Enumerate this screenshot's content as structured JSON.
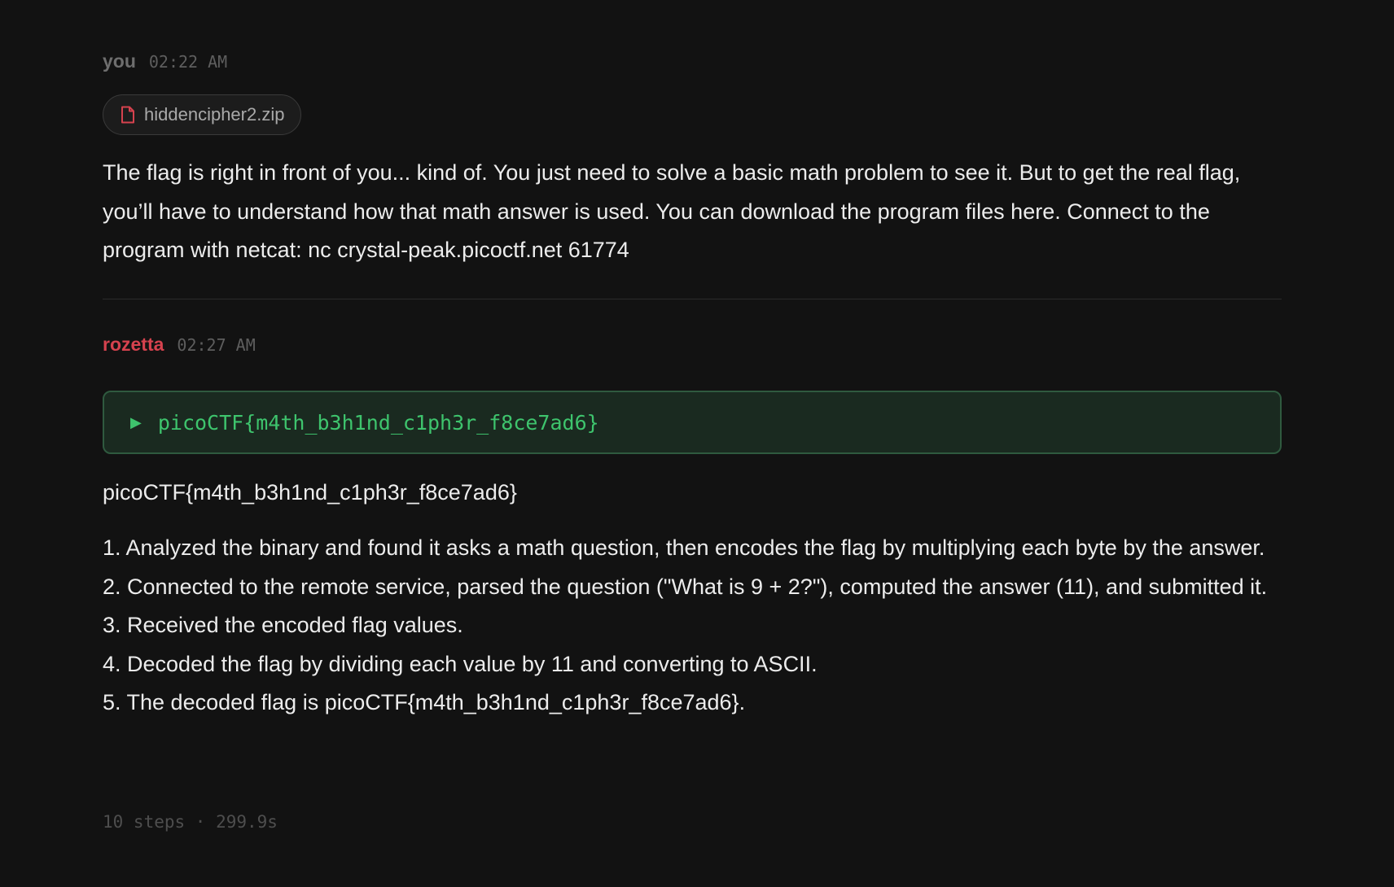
{
  "messages": {
    "user": {
      "author": "you",
      "time": "02:22 AM",
      "attachment": {
        "icon": "file-icon",
        "name": "hiddencipher2.zip"
      },
      "text": "The flag is right in front of you... kind of. You just need to solve a basic math problem to see it. But to get the real flag, you’ll have to understand how that math answer is used. You can download the program files here. Connect to the program with netcat: nc crystal-peak.picoctf.net 61774"
    },
    "bot": {
      "author": "rozetta",
      "time": "02:27 AM",
      "flag_box": {
        "icon": "play-icon",
        "value": "picoCTF{m4th_b3h1nd_c1ph3r_f8ce7ad6}"
      },
      "flag_text": "picoCTF{m4th_b3h1nd_c1ph3r_f8ce7ad6}",
      "steps": [
        "1. Analyzed the binary and found it asks a math question, then encodes the flag by multiplying each byte by the answer.",
        "2. Connected to the remote service, parsed the question (\"What is 9 + 2?\"), computed the answer (11), and submitted it.",
        "3. Received the encoded flag values.",
        "4. Decoded the flag by dividing each value by 11 and converting to ASCII.",
        "5. The decoded flag is picoCTF{m4th_b3h1nd_c1ph3r_f8ce7ad6}."
      ],
      "meta": "10 steps · 299.9s"
    }
  },
  "colors": {
    "background": "#121212",
    "user_author": "#6e6e6e",
    "bot_author": "#d6424e",
    "flag_green": "#3ec46d",
    "flag_box_bg": "#1a2a20",
    "flag_box_border": "#2f5a3f",
    "attachment_icon": "#d6424e"
  }
}
